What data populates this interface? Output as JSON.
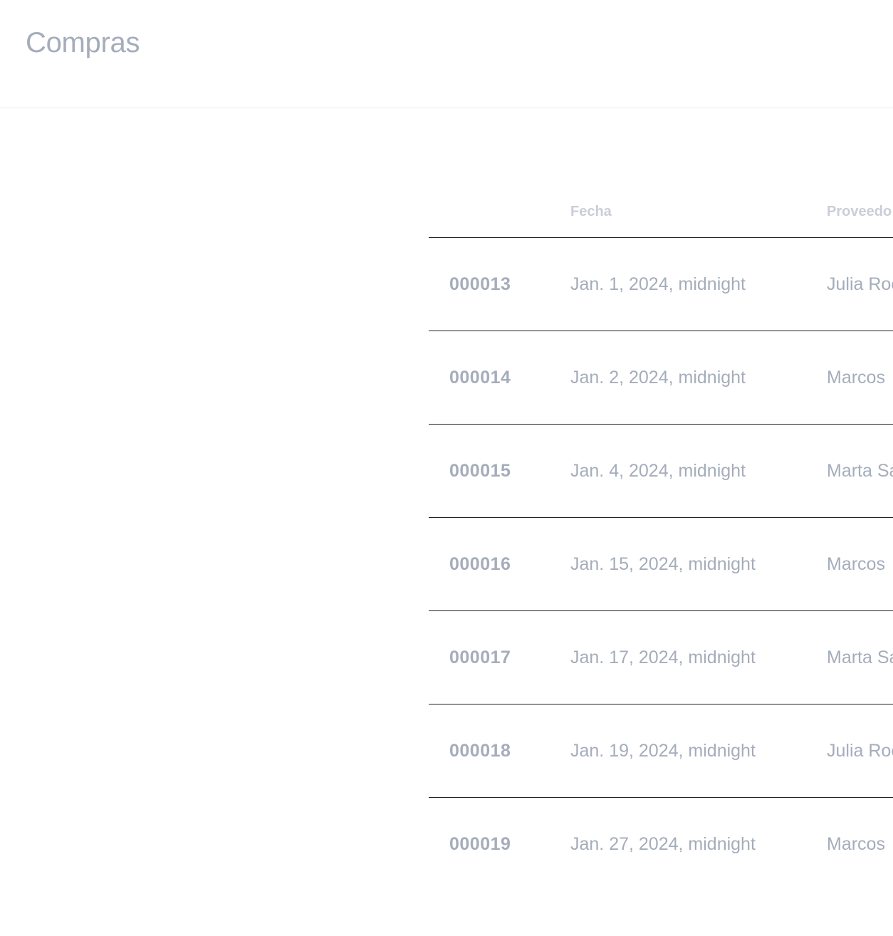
{
  "header": {
    "title": "Compras"
  },
  "table": {
    "columns": [
      "",
      "Fecha",
      "Proveedo"
    ],
    "rows": [
      {
        "id": "000013",
        "fecha": "Jan. 1, 2024, midnight",
        "proveedor": "Julia Roc"
      },
      {
        "id": "000014",
        "fecha": "Jan. 2, 2024, midnight",
        "proveedor": "Marcos"
      },
      {
        "id": "000015",
        "fecha": "Jan. 4, 2024, midnight",
        "proveedor": "Marta Sa"
      },
      {
        "id": "000016",
        "fecha": "Jan. 15, 2024, midnight",
        "proveedor": "Marcos"
      },
      {
        "id": "000017",
        "fecha": "Jan. 17, 2024, midnight",
        "proveedor": "Marta Sa"
      },
      {
        "id": "000018",
        "fecha": "Jan. 19, 2024, midnight",
        "proveedor": "Julia Roc"
      },
      {
        "id": "000019",
        "fecha": "Jan. 27, 2024, midnight",
        "proveedor": "Marcos"
      }
    ]
  }
}
